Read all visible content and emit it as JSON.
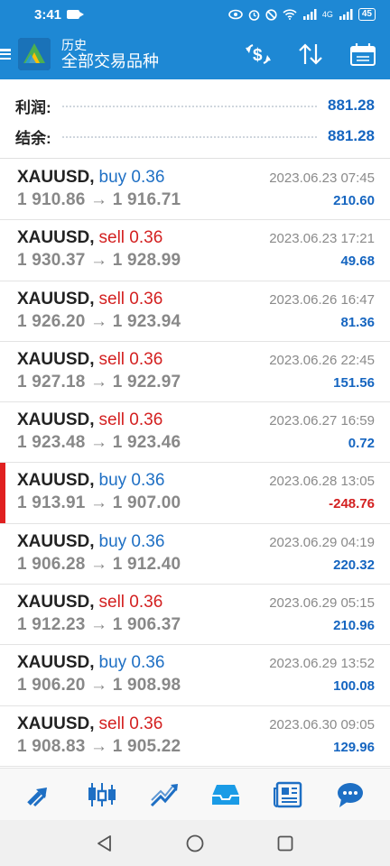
{
  "status_bar": {
    "time": "3:41",
    "network": "4G",
    "battery": "45"
  },
  "header": {
    "subtitle": "历史",
    "title": "全部交易品种"
  },
  "summary": {
    "profit_label": "利润:",
    "profit_value": "881.28",
    "balance_label": "结余:",
    "balance_value": "881.28"
  },
  "colors": {
    "accent": "#1e88d4",
    "buy": "#1e6fc4",
    "sell": "#d32020",
    "profit": "#1565c0"
  },
  "trades": [
    {
      "symbol": "XAUUSD",
      "side": "buy 0.36",
      "type": "buy",
      "time": "2023.06.23 07:45",
      "prices": "1 910.86 → 1 916.71",
      "profit": "210.60"
    },
    {
      "symbol": "XAUUSD",
      "side": "sell 0.36",
      "type": "sell",
      "time": "2023.06.23 17:21",
      "prices": "1 930.37 → 1 928.99",
      "profit": "49.68"
    },
    {
      "symbol": "XAUUSD",
      "side": "sell 0.36",
      "type": "sell",
      "time": "2023.06.26 16:47",
      "prices": "1 926.20 → 1 923.94",
      "profit": "81.36"
    },
    {
      "symbol": "XAUUSD",
      "side": "sell 0.36",
      "type": "sell",
      "time": "2023.06.26 22:45",
      "prices": "1 927.18 → 1 922.97",
      "profit": "151.56"
    },
    {
      "symbol": "XAUUSD",
      "side": "sell 0.36",
      "type": "sell",
      "time": "2023.06.27 16:59",
      "prices": "1 923.48 → 1 923.46",
      "profit": "0.72"
    },
    {
      "symbol": "XAUUSD",
      "side": "buy 0.36",
      "type": "buy",
      "time": "2023.06.28 13:05",
      "prices": "1 913.91 → 1 907.00",
      "profit": "-248.76"
    },
    {
      "symbol": "XAUUSD",
      "side": "buy 0.36",
      "type": "buy",
      "time": "2023.06.29 04:19",
      "prices": "1 906.28 → 1 912.40",
      "profit": "220.32"
    },
    {
      "symbol": "XAUUSD",
      "side": "sell 0.36",
      "type": "sell",
      "time": "2023.06.29 05:15",
      "prices": "1 912.23 → 1 906.37",
      "profit": "210.96"
    },
    {
      "symbol": "XAUUSD",
      "side": "buy 0.36",
      "type": "buy",
      "time": "2023.06.29 13:52",
      "prices": "1 906.20 → 1 908.98",
      "profit": "100.08"
    },
    {
      "symbol": "XAUUSD",
      "side": "sell 0.36",
      "type": "sell",
      "time": "2023.06.30 09:05",
      "prices": "1 908.83 → 1 905.22",
      "profit": "129.96"
    }
  ],
  "bottom_nav": [
    "quotes-icon",
    "chart-icon",
    "trade-icon",
    "history-icon",
    "news-icon",
    "chat-icon"
  ]
}
